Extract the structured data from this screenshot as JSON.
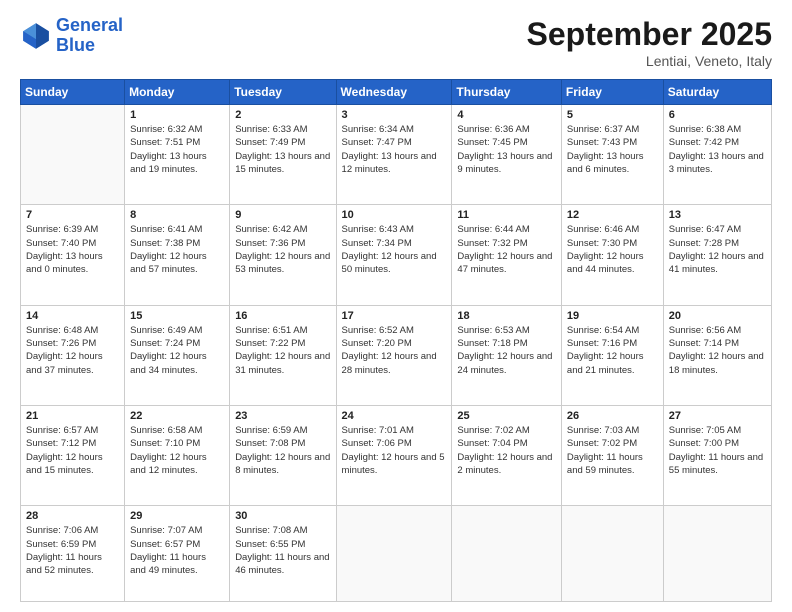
{
  "header": {
    "logo_line1": "General",
    "logo_line2": "Blue",
    "month": "September 2025",
    "location": "Lentiai, Veneto, Italy"
  },
  "weekdays": [
    "Sunday",
    "Monday",
    "Tuesday",
    "Wednesday",
    "Thursday",
    "Friday",
    "Saturday"
  ],
  "weeks": [
    [
      {
        "day": "",
        "empty": true
      },
      {
        "day": "1",
        "sunrise": "Sunrise: 6:32 AM",
        "sunset": "Sunset: 7:51 PM",
        "daylight": "Daylight: 13 hours and 19 minutes."
      },
      {
        "day": "2",
        "sunrise": "Sunrise: 6:33 AM",
        "sunset": "Sunset: 7:49 PM",
        "daylight": "Daylight: 13 hours and 15 minutes."
      },
      {
        "day": "3",
        "sunrise": "Sunrise: 6:34 AM",
        "sunset": "Sunset: 7:47 PM",
        "daylight": "Daylight: 13 hours and 12 minutes."
      },
      {
        "day": "4",
        "sunrise": "Sunrise: 6:36 AM",
        "sunset": "Sunset: 7:45 PM",
        "daylight": "Daylight: 13 hours and 9 minutes."
      },
      {
        "day": "5",
        "sunrise": "Sunrise: 6:37 AM",
        "sunset": "Sunset: 7:43 PM",
        "daylight": "Daylight: 13 hours and 6 minutes."
      },
      {
        "day": "6",
        "sunrise": "Sunrise: 6:38 AM",
        "sunset": "Sunset: 7:42 PM",
        "daylight": "Daylight: 13 hours and 3 minutes."
      }
    ],
    [
      {
        "day": "7",
        "sunrise": "Sunrise: 6:39 AM",
        "sunset": "Sunset: 7:40 PM",
        "daylight": "Daylight: 13 hours and 0 minutes."
      },
      {
        "day": "8",
        "sunrise": "Sunrise: 6:41 AM",
        "sunset": "Sunset: 7:38 PM",
        "daylight": "Daylight: 12 hours and 57 minutes."
      },
      {
        "day": "9",
        "sunrise": "Sunrise: 6:42 AM",
        "sunset": "Sunset: 7:36 PM",
        "daylight": "Daylight: 12 hours and 53 minutes."
      },
      {
        "day": "10",
        "sunrise": "Sunrise: 6:43 AM",
        "sunset": "Sunset: 7:34 PM",
        "daylight": "Daylight: 12 hours and 50 minutes."
      },
      {
        "day": "11",
        "sunrise": "Sunrise: 6:44 AM",
        "sunset": "Sunset: 7:32 PM",
        "daylight": "Daylight: 12 hours and 47 minutes."
      },
      {
        "day": "12",
        "sunrise": "Sunrise: 6:46 AM",
        "sunset": "Sunset: 7:30 PM",
        "daylight": "Daylight: 12 hours and 44 minutes."
      },
      {
        "day": "13",
        "sunrise": "Sunrise: 6:47 AM",
        "sunset": "Sunset: 7:28 PM",
        "daylight": "Daylight: 12 hours and 41 minutes."
      }
    ],
    [
      {
        "day": "14",
        "sunrise": "Sunrise: 6:48 AM",
        "sunset": "Sunset: 7:26 PM",
        "daylight": "Daylight: 12 hours and 37 minutes."
      },
      {
        "day": "15",
        "sunrise": "Sunrise: 6:49 AM",
        "sunset": "Sunset: 7:24 PM",
        "daylight": "Daylight: 12 hours and 34 minutes."
      },
      {
        "day": "16",
        "sunrise": "Sunrise: 6:51 AM",
        "sunset": "Sunset: 7:22 PM",
        "daylight": "Daylight: 12 hours and 31 minutes."
      },
      {
        "day": "17",
        "sunrise": "Sunrise: 6:52 AM",
        "sunset": "Sunset: 7:20 PM",
        "daylight": "Daylight: 12 hours and 28 minutes."
      },
      {
        "day": "18",
        "sunrise": "Sunrise: 6:53 AM",
        "sunset": "Sunset: 7:18 PM",
        "daylight": "Daylight: 12 hours and 24 minutes."
      },
      {
        "day": "19",
        "sunrise": "Sunrise: 6:54 AM",
        "sunset": "Sunset: 7:16 PM",
        "daylight": "Daylight: 12 hours and 21 minutes."
      },
      {
        "day": "20",
        "sunrise": "Sunrise: 6:56 AM",
        "sunset": "Sunset: 7:14 PM",
        "daylight": "Daylight: 12 hours and 18 minutes."
      }
    ],
    [
      {
        "day": "21",
        "sunrise": "Sunrise: 6:57 AM",
        "sunset": "Sunset: 7:12 PM",
        "daylight": "Daylight: 12 hours and 15 minutes."
      },
      {
        "day": "22",
        "sunrise": "Sunrise: 6:58 AM",
        "sunset": "Sunset: 7:10 PM",
        "daylight": "Daylight: 12 hours and 12 minutes."
      },
      {
        "day": "23",
        "sunrise": "Sunrise: 6:59 AM",
        "sunset": "Sunset: 7:08 PM",
        "daylight": "Daylight: 12 hours and 8 minutes."
      },
      {
        "day": "24",
        "sunrise": "Sunrise: 7:01 AM",
        "sunset": "Sunset: 7:06 PM",
        "daylight": "Daylight: 12 hours and 5 minutes."
      },
      {
        "day": "25",
        "sunrise": "Sunrise: 7:02 AM",
        "sunset": "Sunset: 7:04 PM",
        "daylight": "Daylight: 12 hours and 2 minutes."
      },
      {
        "day": "26",
        "sunrise": "Sunrise: 7:03 AM",
        "sunset": "Sunset: 7:02 PM",
        "daylight": "Daylight: 11 hours and 59 minutes."
      },
      {
        "day": "27",
        "sunrise": "Sunrise: 7:05 AM",
        "sunset": "Sunset: 7:00 PM",
        "daylight": "Daylight: 11 hours and 55 minutes."
      }
    ],
    [
      {
        "day": "28",
        "sunrise": "Sunrise: 7:06 AM",
        "sunset": "Sunset: 6:59 PM",
        "daylight": "Daylight: 11 hours and 52 minutes."
      },
      {
        "day": "29",
        "sunrise": "Sunrise: 7:07 AM",
        "sunset": "Sunset: 6:57 PM",
        "daylight": "Daylight: 11 hours and 49 minutes."
      },
      {
        "day": "30",
        "sunrise": "Sunrise: 7:08 AM",
        "sunset": "Sunset: 6:55 PM",
        "daylight": "Daylight: 11 hours and 46 minutes."
      },
      {
        "day": "",
        "empty": true
      },
      {
        "day": "",
        "empty": true
      },
      {
        "day": "",
        "empty": true
      },
      {
        "day": "",
        "empty": true
      }
    ]
  ]
}
